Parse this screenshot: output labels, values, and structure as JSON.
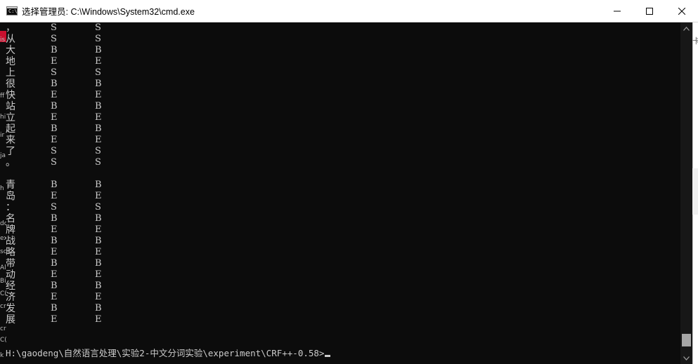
{
  "window": {
    "title": "选择管理员: C:\\Windows\\System32\\cmd.exe",
    "icon": "cmd-icon",
    "icon_label": "C:\\",
    "buttons": {
      "minimize": "minimize-icon",
      "maximize": "maximize-icon",
      "close": "close-icon"
    }
  },
  "console": {
    "rows": [
      {
        "ch": "，",
        "t1": "S",
        "t2": "S"
      },
      {
        "ch": "从",
        "t1": "S",
        "t2": "S"
      },
      {
        "ch": "大",
        "t1": "B",
        "t2": "B"
      },
      {
        "ch": "地",
        "t1": "E",
        "t2": "E"
      },
      {
        "ch": "上",
        "t1": "S",
        "t2": "S"
      },
      {
        "ch": "很",
        "t1": "B",
        "t2": "B"
      },
      {
        "ch": "快",
        "t1": "E",
        "t2": "E"
      },
      {
        "ch": "站",
        "t1": "B",
        "t2": "B"
      },
      {
        "ch": "立",
        "t1": "E",
        "t2": "E"
      },
      {
        "ch": "起",
        "t1": "B",
        "t2": "B"
      },
      {
        "ch": "来",
        "t1": "E",
        "t2": "E"
      },
      {
        "ch": "了",
        "t1": "S",
        "t2": "S"
      },
      {
        "ch": "。",
        "t1": "S",
        "t2": "S"
      },
      {
        "ch": "",
        "t1": "",
        "t2": ""
      },
      {
        "ch": "青",
        "t1": "B",
        "t2": "B"
      },
      {
        "ch": "岛",
        "t1": "E",
        "t2": "E"
      },
      {
        "ch": "：",
        "t1": "S",
        "t2": "S"
      },
      {
        "ch": "名",
        "t1": "B",
        "t2": "B"
      },
      {
        "ch": "牌",
        "t1": "E",
        "t2": "E"
      },
      {
        "ch": "战",
        "t1": "B",
        "t2": "B"
      },
      {
        "ch": "略",
        "t1": "E",
        "t2": "E"
      },
      {
        "ch": "带",
        "t1": "B",
        "t2": "B"
      },
      {
        "ch": "动",
        "t1": "E",
        "t2": "E"
      },
      {
        "ch": "经",
        "t1": "B",
        "t2": "B"
      },
      {
        "ch": "济",
        "t1": "E",
        "t2": "E"
      },
      {
        "ch": "发",
        "t1": "B",
        "t2": "B"
      },
      {
        "ch": "展",
        "t1": "E",
        "t2": "E"
      }
    ],
    "prompt": "H:\\gaodeng\\自然语言处理\\实验2-中文分词实验\\experiment\\CRF++-0.58>"
  },
  "left_strip": {
    "marks": [
      "is",
      "ff",
      "hi",
      "ir",
      "ja",
      "h",
      "dc",
      "ex",
      "sc",
      "Al",
      "Bi",
      "C(",
      "cr",
      "cr",
      "C(",
      "k"
    ]
  },
  "right_edge": {
    "mark": "卡"
  }
}
